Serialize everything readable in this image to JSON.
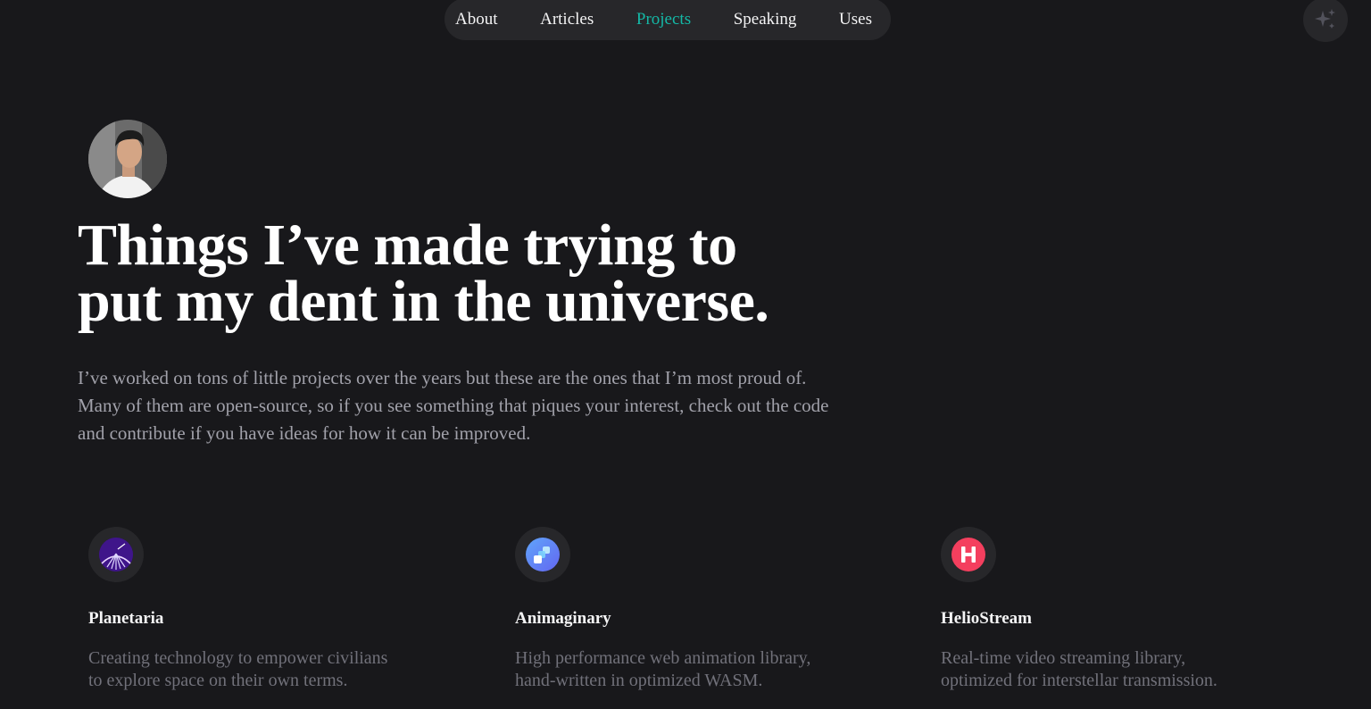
{
  "nav": {
    "items": [
      {
        "label": "About",
        "active": false
      },
      {
        "label": "Articles",
        "active": false
      },
      {
        "label": "Projects",
        "active": true
      },
      {
        "label": "Speaking",
        "active": false
      },
      {
        "label": "Uses",
        "active": false
      }
    ],
    "active_color": "#14b8a6",
    "theme_toggle_icon": "sparkles-icon"
  },
  "hero": {
    "avatar": "profile-photo",
    "title_line1": "Things I’ve made trying to",
    "title_line2": "put my dent in the universe.",
    "intro": "I’ve worked on tons of little projects over the years but these are the ones that I’m most proud of. Many of them are open-source, so if you see something that piques your interest, check out the code and contribute if you have ideas for how it can be improved."
  },
  "projects": [
    {
      "name": "Planetaria",
      "desc_line1": "Creating technology to empower civilians",
      "desc_line2": "to explore space on their own terms.",
      "icon": "planetaria-logo-icon"
    },
    {
      "name": "Animaginary",
      "desc_line1": "High performance web animation library,",
      "desc_line2": "hand-written in optimized WASM.",
      "icon": "animaginary-logo-icon"
    },
    {
      "name": "HelioStream",
      "desc_line1": "Real-time video streaming library,",
      "desc_line2": "optimized for interstellar transmission.",
      "icon": "heliostream-logo-icon"
    }
  ],
  "colors": {
    "background": "#18181b",
    "surface": "#27272a",
    "heading": "#ffffff",
    "body_text": "#a1a1aa",
    "muted_text": "#71717a",
    "accent": "#14b8a6"
  }
}
